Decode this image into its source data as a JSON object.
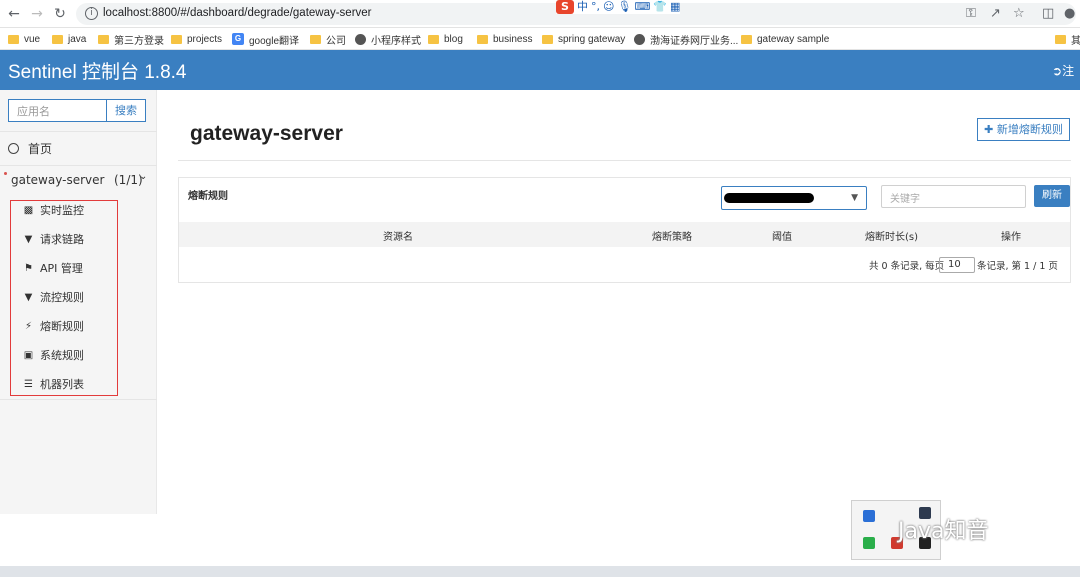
{
  "browser": {
    "url": "localhost:8800/#/dashboard/degrade/gateway-server",
    "ime_items": [
      "中",
      "°,",
      "☺",
      "🎙",
      "⌨",
      "👕",
      "▦"
    ],
    "bookmarks": [
      {
        "label": "vue",
        "icon": "folder-icon"
      },
      {
        "label": "java",
        "icon": "folder-icon"
      },
      {
        "label": "第三方登录",
        "icon": "folder-icon"
      },
      {
        "label": "projects",
        "icon": "folder-icon"
      },
      {
        "label": "google翻译",
        "icon": "google-translate-icon"
      },
      {
        "label": "公司",
        "icon": "folder-icon"
      },
      {
        "label": "小程序样式",
        "icon": "globe-icon"
      },
      {
        "label": "blog",
        "icon": "folder-icon"
      },
      {
        "label": "business",
        "icon": "folder-icon"
      },
      {
        "label": "spring gateway",
        "icon": "folder-icon"
      },
      {
        "label": "渤海证券网厅业务...",
        "icon": "globe-icon"
      },
      {
        "label": "gateway sample",
        "icon": "folder-icon"
      },
      {
        "label": "其",
        "icon": "folder-icon"
      }
    ]
  },
  "header": {
    "title": "Sentinel 控制台 1.8.4",
    "logout_label": "注"
  },
  "sidebar": {
    "search_placeholder": "应用名",
    "search_button": "搜索",
    "home_label": "首页",
    "app_name": "gateway-server",
    "app_count": "(1/1)",
    "menu": [
      {
        "label": "实时监控",
        "icon": "bar-chart-icon"
      },
      {
        "label": "请求链路",
        "icon": "filter-icon"
      },
      {
        "label": "API 管理",
        "icon": "tags-icon"
      },
      {
        "label": "流控规则",
        "icon": "filter-icon"
      },
      {
        "label": "熔断规则",
        "icon": "flash-icon"
      },
      {
        "label": "系统规则",
        "icon": "lock-icon"
      },
      {
        "label": "机器列表",
        "icon": "list-icon"
      }
    ]
  },
  "main": {
    "title": "gateway-server",
    "add_button": "新增熔断规则",
    "panel_title": "熔断规则",
    "keyword_placeholder": "关键字",
    "refresh_button": "刷新",
    "columns": [
      "资源名",
      "熔断策略",
      "阈值",
      "熔断时长(s)",
      "操作"
    ],
    "pagination_prefix": "共 0 条记录, 每页",
    "page_size": "10",
    "pagination_suffix": "条记录, 第 1 / 1 页"
  },
  "watermark": "Java知音"
}
